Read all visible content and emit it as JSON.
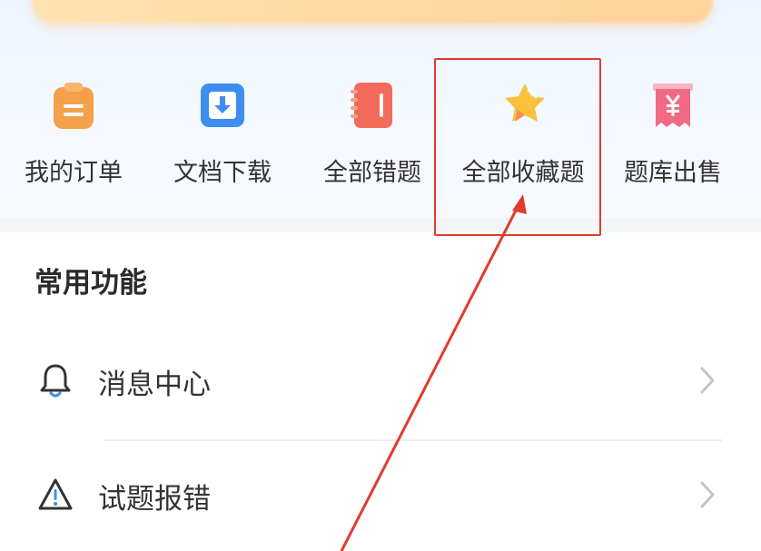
{
  "shortcuts": [
    {
      "label": "我的订单",
      "icon": "clipboard-icon"
    },
    {
      "label": "文档下载",
      "icon": "download-icon"
    },
    {
      "label": "全部错题",
      "icon": "notebook-icon"
    },
    {
      "label": "全部收藏题",
      "icon": "star-icon"
    },
    {
      "label": "题库出售",
      "icon": "yen-ticket-icon"
    }
  ],
  "common_functions": {
    "title": "常用功能",
    "items": [
      {
        "label": "消息中心",
        "icon": "bell-icon"
      },
      {
        "label": "试题报错",
        "icon": "warning-icon"
      }
    ]
  },
  "colors": {
    "highlight": "#e23a2e",
    "order_icon": "#f5a04a",
    "download_icon": "#3d8ef0",
    "notebook_icon": "#f36b5b",
    "star_icon": "#f9c13d",
    "ticket_icon": "#f06a85"
  },
  "annotation": {
    "highlighted_item": "全部收藏题"
  }
}
